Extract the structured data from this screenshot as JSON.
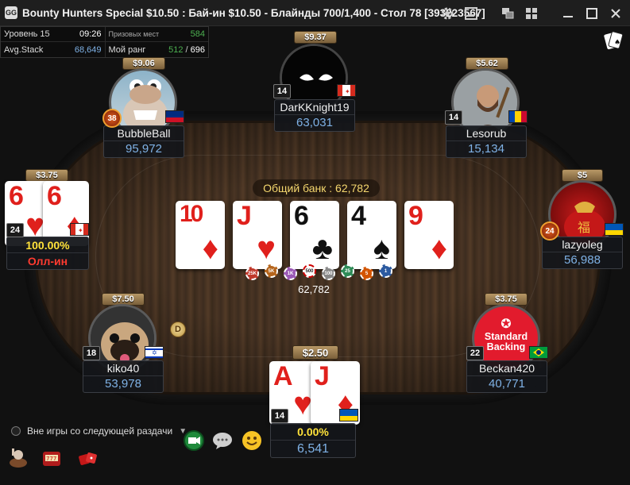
{
  "window": {
    "title": "Bounty Hunters Special $10.50 : Бай-ин $10.50 - Блайнды 700/1,400 - Стол 78 [393223567]",
    "logo": "GG"
  },
  "info": {
    "level_label": "Уровень 15",
    "level_time": "09:26",
    "prize_places_label": "Призовых мест",
    "prize_places_value": "584",
    "avg_stack_label": "Avg.Stack",
    "avg_stack_value": "68,649",
    "rank_label": "Мой ранг",
    "rank_value": "512",
    "rank_sep": " / ",
    "rank_total": "696"
  },
  "pot": {
    "label": "Общий банк : 62,782",
    "value": "62,782"
  },
  "board": [
    {
      "rank": "10",
      "suit": "♦",
      "color": "red"
    },
    {
      "rank": "J",
      "suit": "♥",
      "color": "red"
    },
    {
      "rank": "6",
      "suit": "♣",
      "color": "black"
    },
    {
      "rank": "4",
      "suit": "♠",
      "color": "black"
    },
    {
      "rank": "9",
      "suit": "♦",
      "color": "red"
    }
  ],
  "chips": [
    "25K",
    "5K",
    "1K",
    "500",
    "100",
    "25",
    "5",
    "1"
  ],
  "players": {
    "darkknight": {
      "name": "DarKKnight19",
      "stack": "63,031",
      "bounty": "$9.37",
      "level": "14"
    },
    "bubbleball": {
      "name": "BubbleBall",
      "stack": "95,972",
      "bounty": "$9.06",
      "level": "38"
    },
    "lesorub": {
      "name": "Lesorub",
      "stack": "15,134",
      "bounty": "$5.62",
      "level": "14"
    },
    "left_allin": {
      "bounty": "$3.75",
      "level": "24",
      "equity": "100.00%",
      "status": "Олл-ин",
      "cards": [
        {
          "rank": "6",
          "suit": "♥",
          "color": "red"
        },
        {
          "rank": "6",
          "suit": "♦",
          "color": "red"
        }
      ]
    },
    "lazyoleg": {
      "name": "lazyoleg",
      "stack": "56,988",
      "bounty": "$5",
      "level": "24"
    },
    "kiko40": {
      "name": "kiko40",
      "stack": "53,978",
      "bounty": "$7.50",
      "level": "18"
    },
    "beckan": {
      "name": "Beckan420",
      "stack": "40,771",
      "bounty": "$3.75",
      "level": "22",
      "logo_line1": "Standard",
      "logo_line2": "Backing"
    },
    "hero": {
      "bounty": "$2.50",
      "level": "14",
      "equity": "0.00%",
      "stack": "6,541",
      "cards": [
        {
          "rank": "A",
          "suit": "♥",
          "color": "red"
        },
        {
          "rank": "J",
          "suit": "♦",
          "color": "red"
        }
      ]
    }
  },
  "dealer_button": "D",
  "bottom": {
    "sitout_label": "Вне игры со следующей раздачи"
  },
  "colors": {
    "stack_blue": "#7fb2e6",
    "pot_gold": "#f5d76e",
    "equity_yellow": "#ffe23a",
    "allin_red": "#ff3b30",
    "prize_green": "#4caf50"
  }
}
